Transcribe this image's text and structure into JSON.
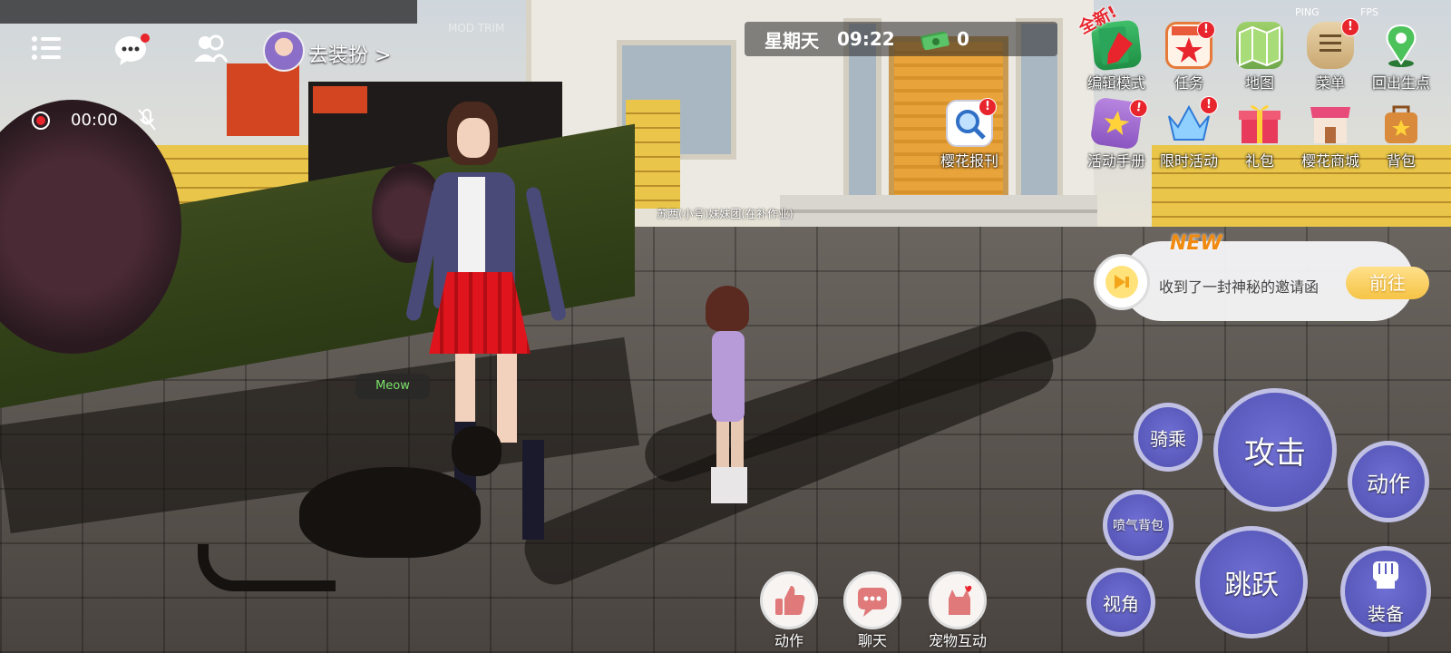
{
  "topbar": {
    "dress_up_label": "去装扮 >",
    "record_time": "00:00",
    "day": "星期天",
    "clock": "09:22",
    "money": "0",
    "watermark": "MOD TRIM",
    "ping_label": "PING",
    "fps_label": "FPS"
  },
  "top_menu": [
    {
      "label": "编辑模式",
      "icon": "edit-mode-icon",
      "badge_text": "全新!"
    },
    {
      "label": "任务",
      "icon": "task-calendar-icon",
      "badge": "!"
    },
    {
      "label": "地图",
      "icon": "map-icon"
    },
    {
      "label": "菜单",
      "icon": "menu-scroll-icon",
      "badge": "!"
    },
    {
      "label": "回出生点",
      "icon": "spawn-pin-icon"
    }
  ],
  "second_menu": [
    {
      "label": "樱花报刊",
      "icon": "news-search-icon",
      "badge": "!"
    },
    {
      "label": "活动手册",
      "icon": "activity-book-icon",
      "badge": "!"
    },
    {
      "label": "限时活动",
      "icon": "crown-icon",
      "badge": "!"
    },
    {
      "label": "礼包",
      "icon": "gift-icon"
    },
    {
      "label": "樱花商城",
      "icon": "shop-icon"
    },
    {
      "label": "背包",
      "icon": "backpack-icon"
    }
  ],
  "world": {
    "npc_name": "苏西(小号)妹妹团(在补作业)",
    "pet_bubble": "Meow"
  },
  "notice": {
    "new_tag": "NEW",
    "message": "收到了一封神秘的邀请函",
    "go_label": "前往"
  },
  "actions": {
    "ride": "骑乘",
    "attack": "攻击",
    "action": "动作",
    "jetpack": "喷气背包",
    "jump": "跳跃",
    "view": "视角",
    "equip": "装备"
  },
  "bottom_bar": [
    {
      "label": "动作",
      "icon": "thumbs-up-icon"
    },
    {
      "label": "聊天",
      "icon": "chat-bubble-icon"
    },
    {
      "label": "宠物互动",
      "icon": "pet-icon"
    }
  ],
  "colors": {
    "accent_purple": "#5a5ac0",
    "badge_red": "#e8242c",
    "new_orange": "#f08a10",
    "money_green": "#3fa24a"
  }
}
